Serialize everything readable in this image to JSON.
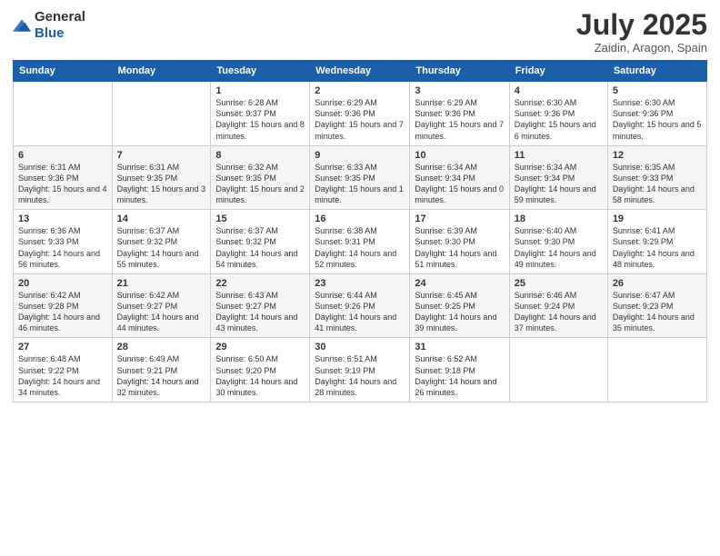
{
  "logo": {
    "general": "General",
    "blue": "Blue"
  },
  "title": {
    "month": "July 2025",
    "location": "Zaidin, Aragon, Spain"
  },
  "weekdays": [
    "Sunday",
    "Monday",
    "Tuesday",
    "Wednesday",
    "Thursday",
    "Friday",
    "Saturday"
  ],
  "weeks": [
    [
      {
        "day": "",
        "info": ""
      },
      {
        "day": "",
        "info": ""
      },
      {
        "day": "1",
        "info": "Sunrise: 6:28 AM\nSunset: 9:37 PM\nDaylight: 15 hours and 8 minutes."
      },
      {
        "day": "2",
        "info": "Sunrise: 6:29 AM\nSunset: 9:36 PM\nDaylight: 15 hours and 7 minutes."
      },
      {
        "day": "3",
        "info": "Sunrise: 6:29 AM\nSunset: 9:36 PM\nDaylight: 15 hours and 7 minutes."
      },
      {
        "day": "4",
        "info": "Sunrise: 6:30 AM\nSunset: 9:36 PM\nDaylight: 15 hours and 6 minutes."
      },
      {
        "day": "5",
        "info": "Sunrise: 6:30 AM\nSunset: 9:36 PM\nDaylight: 15 hours and 5 minutes."
      }
    ],
    [
      {
        "day": "6",
        "info": "Sunrise: 6:31 AM\nSunset: 9:36 PM\nDaylight: 15 hours and 4 minutes."
      },
      {
        "day": "7",
        "info": "Sunrise: 6:31 AM\nSunset: 9:35 PM\nDaylight: 15 hours and 3 minutes."
      },
      {
        "day": "8",
        "info": "Sunrise: 6:32 AM\nSunset: 9:35 PM\nDaylight: 15 hours and 2 minutes."
      },
      {
        "day": "9",
        "info": "Sunrise: 6:33 AM\nSunset: 9:35 PM\nDaylight: 15 hours and 1 minute."
      },
      {
        "day": "10",
        "info": "Sunrise: 6:34 AM\nSunset: 9:34 PM\nDaylight: 15 hours and 0 minutes."
      },
      {
        "day": "11",
        "info": "Sunrise: 6:34 AM\nSunset: 9:34 PM\nDaylight: 14 hours and 59 minutes."
      },
      {
        "day": "12",
        "info": "Sunrise: 6:35 AM\nSunset: 9:33 PM\nDaylight: 14 hours and 58 minutes."
      }
    ],
    [
      {
        "day": "13",
        "info": "Sunrise: 6:36 AM\nSunset: 9:33 PM\nDaylight: 14 hours and 56 minutes."
      },
      {
        "day": "14",
        "info": "Sunrise: 6:37 AM\nSunset: 9:32 PM\nDaylight: 14 hours and 55 minutes."
      },
      {
        "day": "15",
        "info": "Sunrise: 6:37 AM\nSunset: 9:32 PM\nDaylight: 14 hours and 54 minutes."
      },
      {
        "day": "16",
        "info": "Sunrise: 6:38 AM\nSunset: 9:31 PM\nDaylight: 14 hours and 52 minutes."
      },
      {
        "day": "17",
        "info": "Sunrise: 6:39 AM\nSunset: 9:30 PM\nDaylight: 14 hours and 51 minutes."
      },
      {
        "day": "18",
        "info": "Sunrise: 6:40 AM\nSunset: 9:30 PM\nDaylight: 14 hours and 49 minutes."
      },
      {
        "day": "19",
        "info": "Sunrise: 6:41 AM\nSunset: 9:29 PM\nDaylight: 14 hours and 48 minutes."
      }
    ],
    [
      {
        "day": "20",
        "info": "Sunrise: 6:42 AM\nSunset: 9:28 PM\nDaylight: 14 hours and 46 minutes."
      },
      {
        "day": "21",
        "info": "Sunrise: 6:42 AM\nSunset: 9:27 PM\nDaylight: 14 hours and 44 minutes."
      },
      {
        "day": "22",
        "info": "Sunrise: 6:43 AM\nSunset: 9:27 PM\nDaylight: 14 hours and 43 minutes."
      },
      {
        "day": "23",
        "info": "Sunrise: 6:44 AM\nSunset: 9:26 PM\nDaylight: 14 hours and 41 minutes."
      },
      {
        "day": "24",
        "info": "Sunrise: 6:45 AM\nSunset: 9:25 PM\nDaylight: 14 hours and 39 minutes."
      },
      {
        "day": "25",
        "info": "Sunrise: 6:46 AM\nSunset: 9:24 PM\nDaylight: 14 hours and 37 minutes."
      },
      {
        "day": "26",
        "info": "Sunrise: 6:47 AM\nSunset: 9:23 PM\nDaylight: 14 hours and 35 minutes."
      }
    ],
    [
      {
        "day": "27",
        "info": "Sunrise: 6:48 AM\nSunset: 9:22 PM\nDaylight: 14 hours and 34 minutes."
      },
      {
        "day": "28",
        "info": "Sunrise: 6:49 AM\nSunset: 9:21 PM\nDaylight: 14 hours and 32 minutes."
      },
      {
        "day": "29",
        "info": "Sunrise: 6:50 AM\nSunset: 9:20 PM\nDaylight: 14 hours and 30 minutes."
      },
      {
        "day": "30",
        "info": "Sunrise: 6:51 AM\nSunset: 9:19 PM\nDaylight: 14 hours and 28 minutes."
      },
      {
        "day": "31",
        "info": "Sunrise: 6:52 AM\nSunset: 9:18 PM\nDaylight: 14 hours and 26 minutes."
      },
      {
        "day": "",
        "info": ""
      },
      {
        "day": "",
        "info": ""
      }
    ]
  ]
}
